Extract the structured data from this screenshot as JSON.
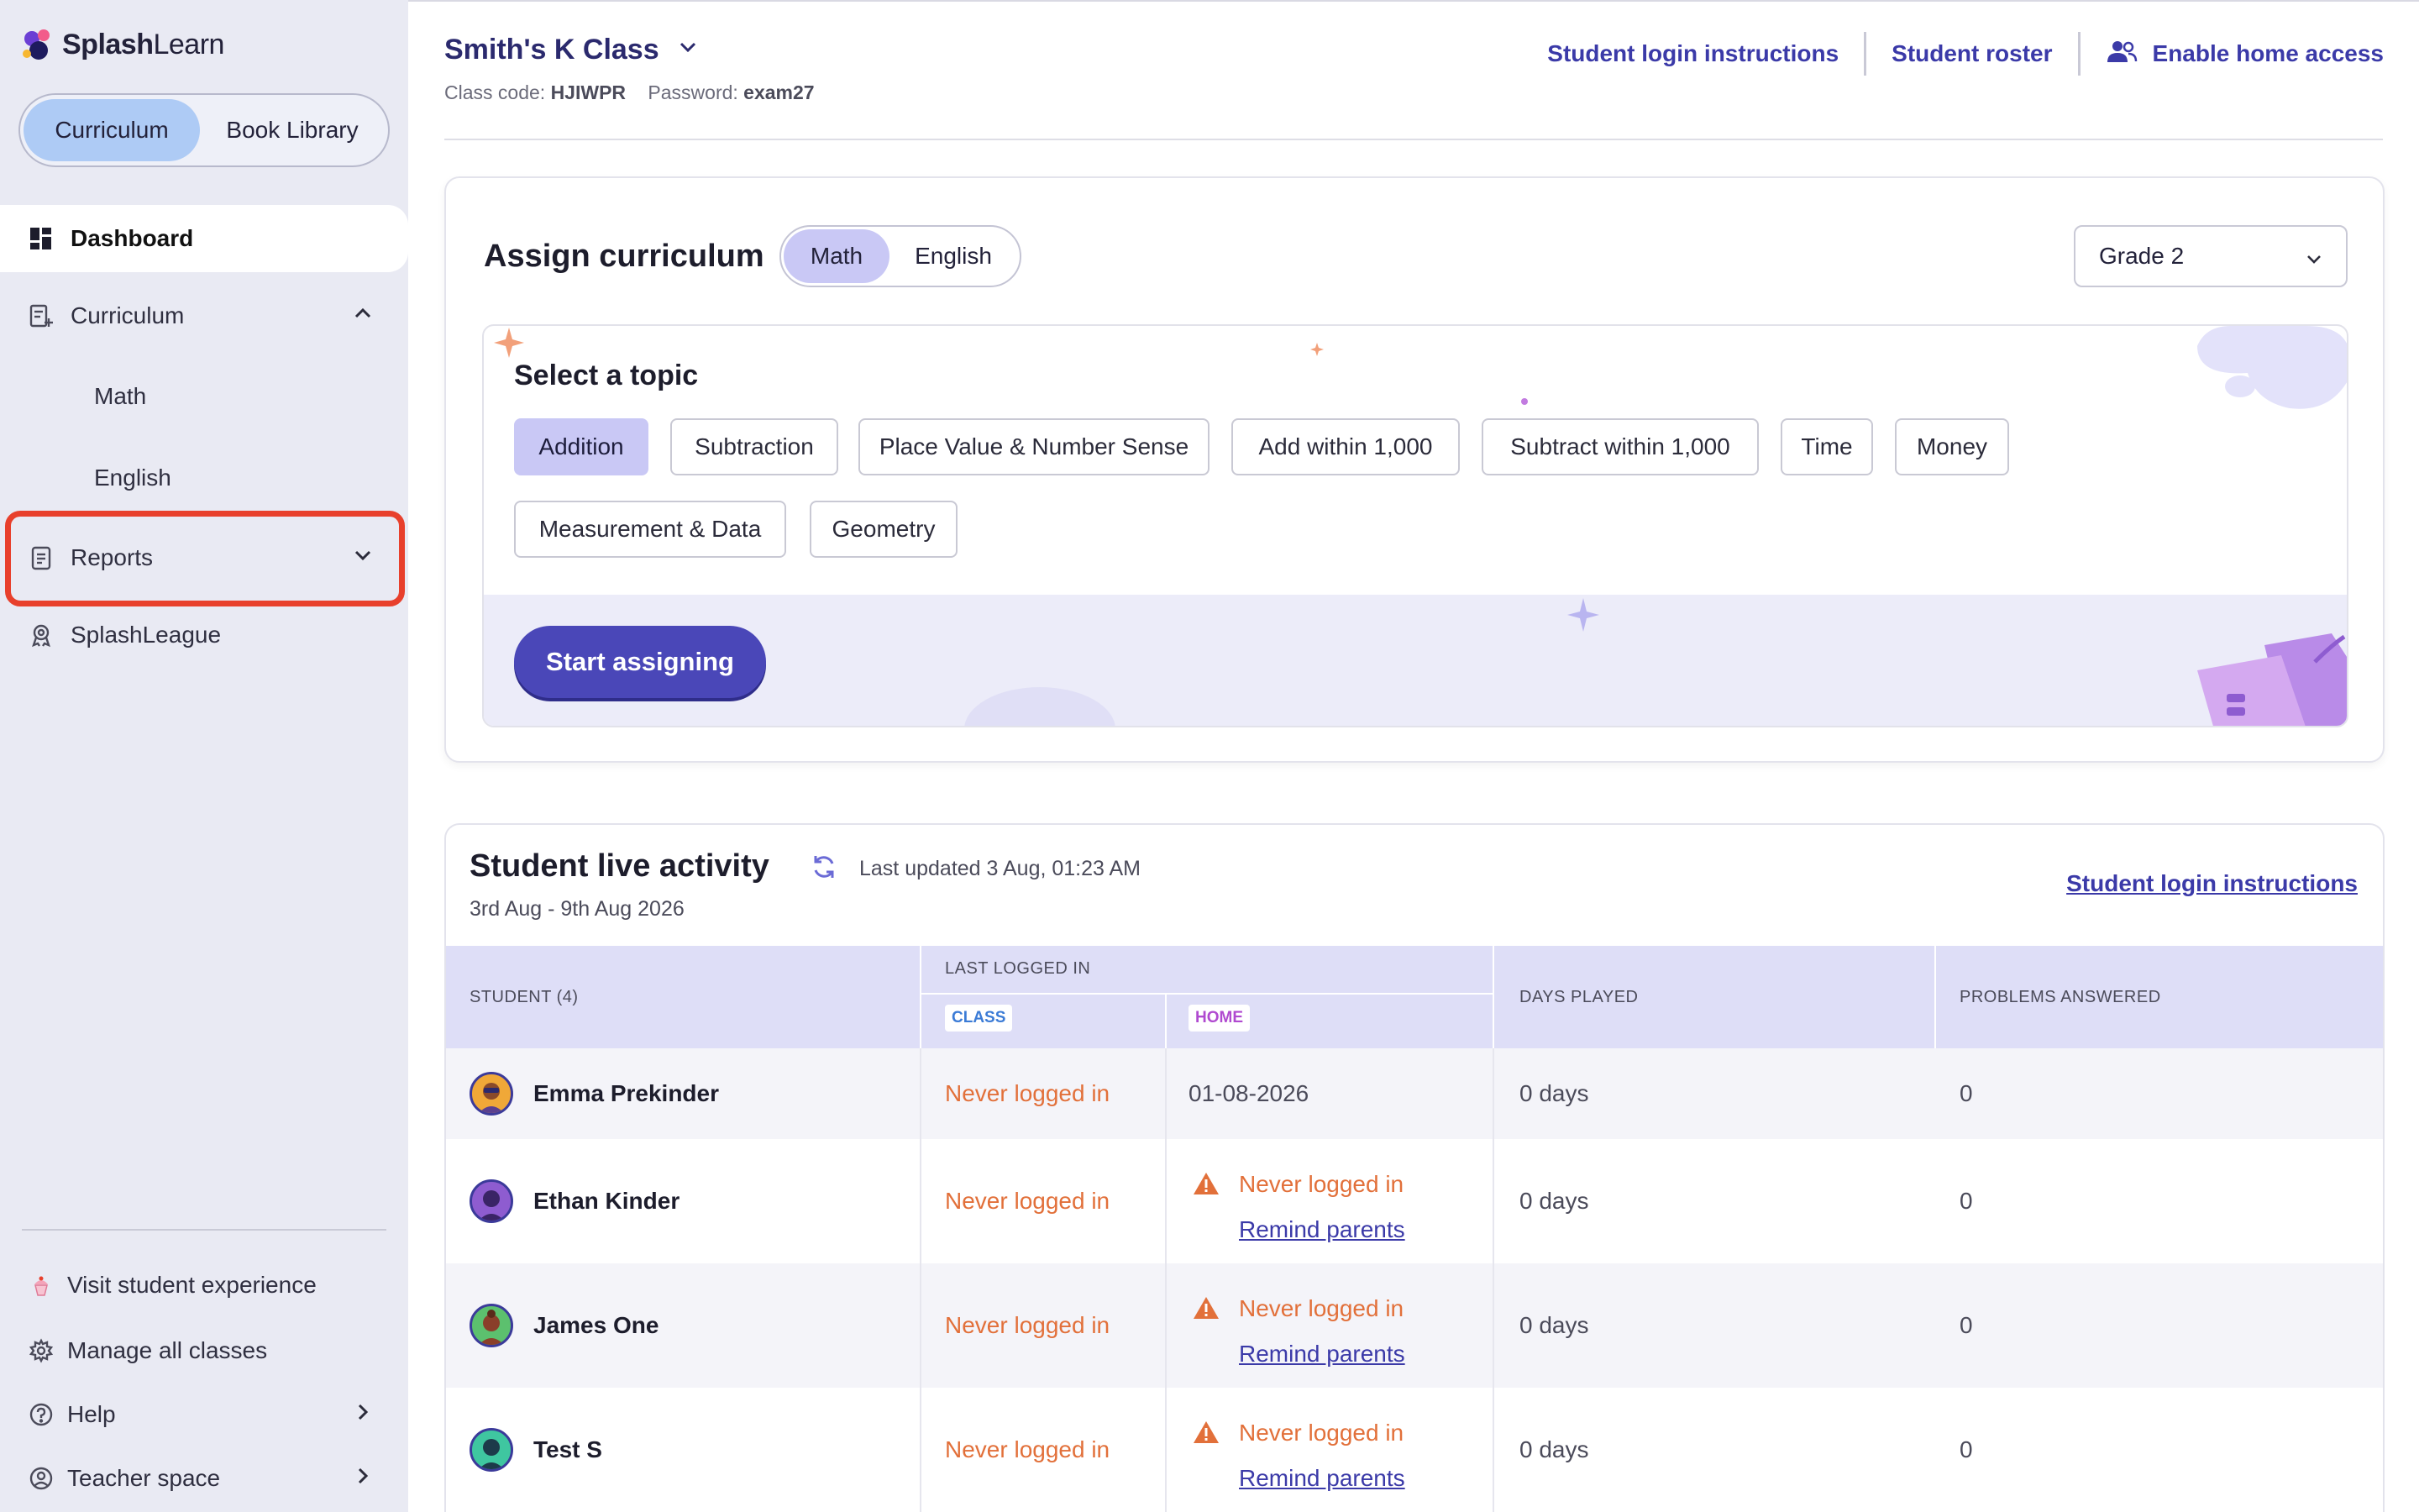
{
  "brand": {
    "name_bold": "Splash",
    "name_rest": "Learn"
  },
  "colors": {
    "accent": "#4a47b8",
    "link": "#3b3aa8",
    "warning": "#e2703a",
    "highlight": "#e8402c",
    "sidebar_bg": "#e9eaf3"
  },
  "sidebar": {
    "library_toggle": {
      "active": "Curriculum",
      "inactive": "Book Library"
    },
    "dashboard": "Dashboard",
    "curriculum": {
      "label": "Curriculum",
      "children": [
        "Math",
        "English"
      ]
    },
    "reports": "Reports",
    "splashleague": "SplashLeague",
    "footer": {
      "visit": "Visit student experience",
      "manage": "Manage all classes",
      "help": "Help",
      "teacher": "Teacher space"
    }
  },
  "header": {
    "class_name": "Smith's K Class",
    "class_code_label": "Class code:",
    "class_code": "HJIWPR",
    "password_label": "Password:",
    "password": "exam27",
    "links": {
      "login": "Student login instructions",
      "roster": "Student roster",
      "home_access": "Enable home access"
    }
  },
  "assign": {
    "title": "Assign curriculum",
    "subjects": {
      "active": "Math",
      "inactive": "English"
    },
    "grade": "Grade 2",
    "topic_title": "Select a topic",
    "topics": [
      "Addition",
      "Subtraction",
      "Place Value & Number Sense",
      "Add within 1,000",
      "Subtract within 1,000",
      "Time",
      "Money",
      "Measurement & Data",
      "Geometry"
    ],
    "selected_topic": "Addition",
    "start_button": "Start assigning"
  },
  "activity": {
    "title": "Student live activity",
    "updated": "Last updated 3 Aug, 01:23 AM",
    "range": "3rd Aug - 9th Aug 2026",
    "login_link": "Student login instructions",
    "columns": {
      "student": "STUDENT (4)",
      "last_logged": "LAST LOGGED IN",
      "class": "CLASS",
      "home": "HOME",
      "days": "DAYS PLAYED",
      "problems": "PROBLEMS ANSWERED"
    },
    "rows": [
      {
        "name": "Emma Prekinder",
        "class": "Never logged in",
        "home": "01-08-2026",
        "remind": "",
        "days": "0 days",
        "problems": "0"
      },
      {
        "name": "Ethan Kinder",
        "class": "Never logged in",
        "home": "Never logged in",
        "remind": "Remind parents",
        "days": "0 days",
        "problems": "0"
      },
      {
        "name": "James One",
        "class": "Never logged in",
        "home": "Never logged in",
        "remind": "Remind parents",
        "days": "0 days",
        "problems": "0"
      },
      {
        "name": "Test S",
        "class": "Never logged in",
        "home": "Never logged in",
        "remind": "Remind parents",
        "days": "0 days",
        "problems": "0"
      }
    ]
  }
}
